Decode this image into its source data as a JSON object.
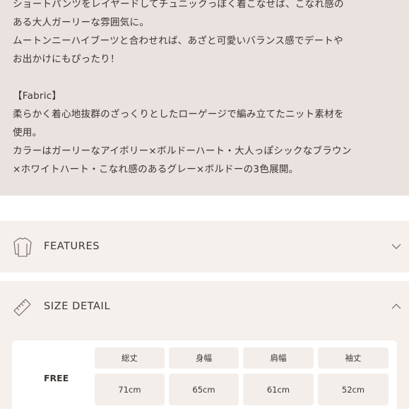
{
  "description": {
    "text": "ショートパンツをレイヤードしてチュニックっぽく着こなせば、こなれ感の\nある大人ガーリーな雰囲気に。\nムートンニーハイブーツと合わせれば、あざと可愛いバランス感でデートや\nお出かけにもぴったり！\n\n【Fabric】\n柔らかく着心地抜群のざっくりとしたローゲージで編み立てたニット素材を\n使用。\nカラーはガーリーなアイボリー×ボルドーハート・大人っぽシックなブラウン\n×ホワイトハート・こなれ感のあるグレー×ボルドーの3色展開。"
  },
  "features": {
    "label": "FEATURES",
    "icon": "sweater-icon",
    "expanded": false
  },
  "size_detail": {
    "label": "SIZE DETAIL",
    "icon": "ruler-icon",
    "expanded": true,
    "table": {
      "headers": [
        "総丈",
        "身幅",
        "肩幅",
        "袖丈"
      ],
      "rows": [
        {
          "size": "FREE",
          "values": [
            "71cm",
            "65cm",
            "61cm",
            "52cm"
          ]
        }
      ]
    }
  },
  "colors": {
    "description_bg": "#e9e2de",
    "row_bg": "#f5f0ec",
    "text": "#3b3634"
  }
}
